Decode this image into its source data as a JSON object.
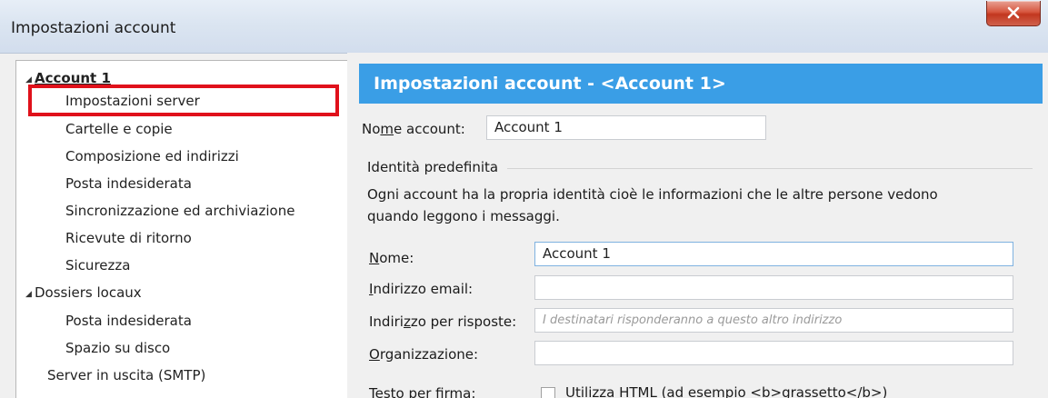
{
  "window": {
    "title": "Impostazioni account",
    "close_label": "close"
  },
  "tree": {
    "items": [
      {
        "label": "Account 1",
        "level": 0,
        "expanded": true
      },
      {
        "label": "Impostazioni server",
        "level": 1,
        "highlighted": true
      },
      {
        "label": "Cartelle e copie",
        "level": 1
      },
      {
        "label": "Composizione ed indirizzi",
        "level": 1
      },
      {
        "label": "Posta indesiderata",
        "level": 1
      },
      {
        "label": "Sincronizzazione ed archiviazione",
        "level": 1
      },
      {
        "label": "Ricevute di ritorno",
        "level": 1
      },
      {
        "label": "Sicurezza",
        "level": 1
      },
      {
        "label": "Dossiers locaux",
        "level": 0,
        "expanded": true
      },
      {
        "label": "Posta indesiderata",
        "level": 1
      },
      {
        "label": "Spazio su disco",
        "level": 1
      },
      {
        "label": "Server in uscita (SMTP)",
        "level": 0
      }
    ]
  },
  "panel": {
    "header": "Impostazioni account - <Account 1>",
    "account_name_label": "Nome account:",
    "account_name_value": "Account 1",
    "identity_group_title": "Identità predefinita",
    "identity_desc_line1": "Ogni account ha la propria identità cioè le informazioni che le altre persone vedono",
    "identity_desc_line2": "quando leggono i messaggi.",
    "name_label": "Nome:",
    "name_value": "Account 1",
    "email_label": "Indirizzo email:",
    "email_value": "",
    "reply_label": "Indirizzo per risposte:",
    "reply_placeholder": "I destinatari risponderanno a questo altro indirizzo",
    "org_label": "Organizzazione:",
    "org_value": "",
    "signature_label": "Testo per firma:",
    "signature_html_label": "Utilizza HTML (ad esempio <b>grassetto</b>)"
  },
  "colors": {
    "header_blue": "#3a9ee6",
    "highlight_red": "#e0111b",
    "close_red": "#c2371f"
  }
}
